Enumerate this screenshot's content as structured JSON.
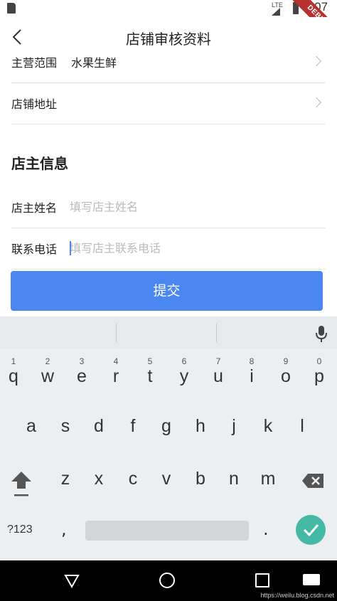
{
  "status_bar": {
    "time": "8:07",
    "network": "LTE",
    "debug_label": "DEBUG"
  },
  "app_bar": {
    "title": "店铺审核资料"
  },
  "form": {
    "business_scope": {
      "label": "主营范围",
      "value": "水果生鲜"
    },
    "store_address": {
      "label": "店铺地址"
    },
    "section_title": "店主信息",
    "owner_name": {
      "label": "店主姓名",
      "placeholder": "填写店主姓名"
    },
    "owner_phone": {
      "label": "联系电话",
      "placeholder": "填写店主联系电话"
    },
    "submit_label": "提交"
  },
  "keyboard": {
    "row1": [
      {
        "hint": "1",
        "ch": "q"
      },
      {
        "hint": "2",
        "ch": "w"
      },
      {
        "hint": "3",
        "ch": "e"
      },
      {
        "hint": "4",
        "ch": "r"
      },
      {
        "hint": "5",
        "ch": "t"
      },
      {
        "hint": "6",
        "ch": "y"
      },
      {
        "hint": "7",
        "ch": "u"
      },
      {
        "hint": "8",
        "ch": "i"
      },
      {
        "hint": "9",
        "ch": "o"
      },
      {
        "hint": "0",
        "ch": "p"
      }
    ],
    "row2": [
      "a",
      "s",
      "d",
      "f",
      "g",
      "h",
      "j",
      "k",
      "l"
    ],
    "row3": [
      "z",
      "x",
      "c",
      "v",
      "b",
      "n",
      "m"
    ],
    "symbols_label": "?123",
    "comma": ",",
    "period": "."
  },
  "watermark": "https://weilu.blog.csdn.net",
  "colors": {
    "primary": "#4a87f0",
    "enter_key": "#43b9a6",
    "debug_banner": "#b8312f"
  }
}
